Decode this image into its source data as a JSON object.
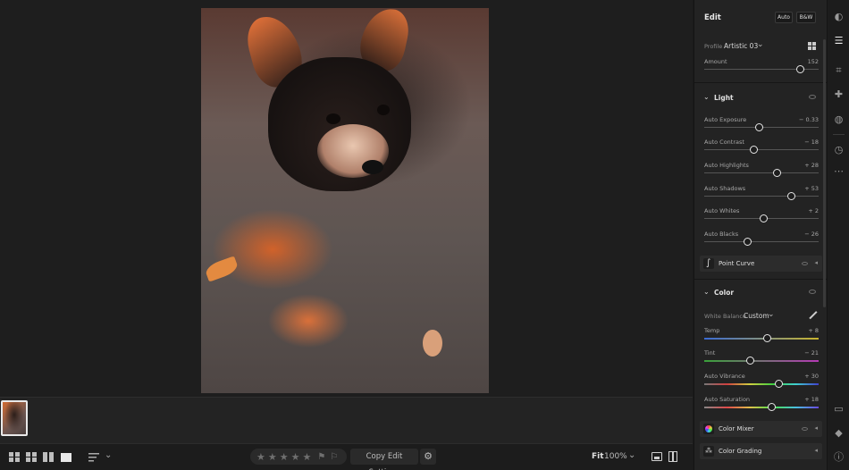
{
  "panel": {
    "title": "Edit",
    "auto_label": "Auto",
    "bw_label": "B&W",
    "profile_label": "Profile",
    "profile_value": "Artistic 03",
    "amount": {
      "label": "Amount",
      "value": "152",
      "fraction": 0.84
    }
  },
  "light": {
    "title": "Light",
    "sliders": [
      {
        "label": "Auto Exposure",
        "value": "− 0.33",
        "fraction": 0.48
      },
      {
        "label": "Auto Contrast",
        "value": "− 18",
        "fraction": 0.43
      },
      {
        "label": "Auto Highlights",
        "value": "+ 28",
        "fraction": 0.64
      },
      {
        "label": "Auto Shadows",
        "value": "+ 53",
        "fraction": 0.76
      },
      {
        "label": "Auto Whites",
        "value": "+ 2",
        "fraction": 0.52
      },
      {
        "label": "Auto Blacks",
        "value": "− 26",
        "fraction": 0.38
      }
    ],
    "point_curve": "Point Curve"
  },
  "color": {
    "title": "Color",
    "wb_label": "White Balance",
    "wb_value": "Custom",
    "sliders": [
      {
        "label": "Temp",
        "value": "+ 8",
        "fraction": 0.55
      },
      {
        "label": "Tint",
        "value": "− 21",
        "fraction": 0.4
      },
      {
        "label": "Auto Vibrance",
        "value": "+ 30",
        "fraction": 0.65
      },
      {
        "label": "Auto Saturation",
        "value": "+ 18",
        "fraction": 0.59
      }
    ],
    "color_mixer": "Color Mixer",
    "color_grading": "Color Grading"
  },
  "bottom": {
    "copy_edit": "Copy Edit Settings",
    "fit": "Fit",
    "zoom": "100%",
    "stars": [
      "★",
      "★",
      "★",
      "★",
      "★"
    ]
  },
  "tools": [
    "edit-icon",
    "crop-icon",
    "healing-icon",
    "masking-icon",
    "history-icon",
    "more-icon",
    "comment-icon",
    "tag-icon",
    "info-icon"
  ]
}
